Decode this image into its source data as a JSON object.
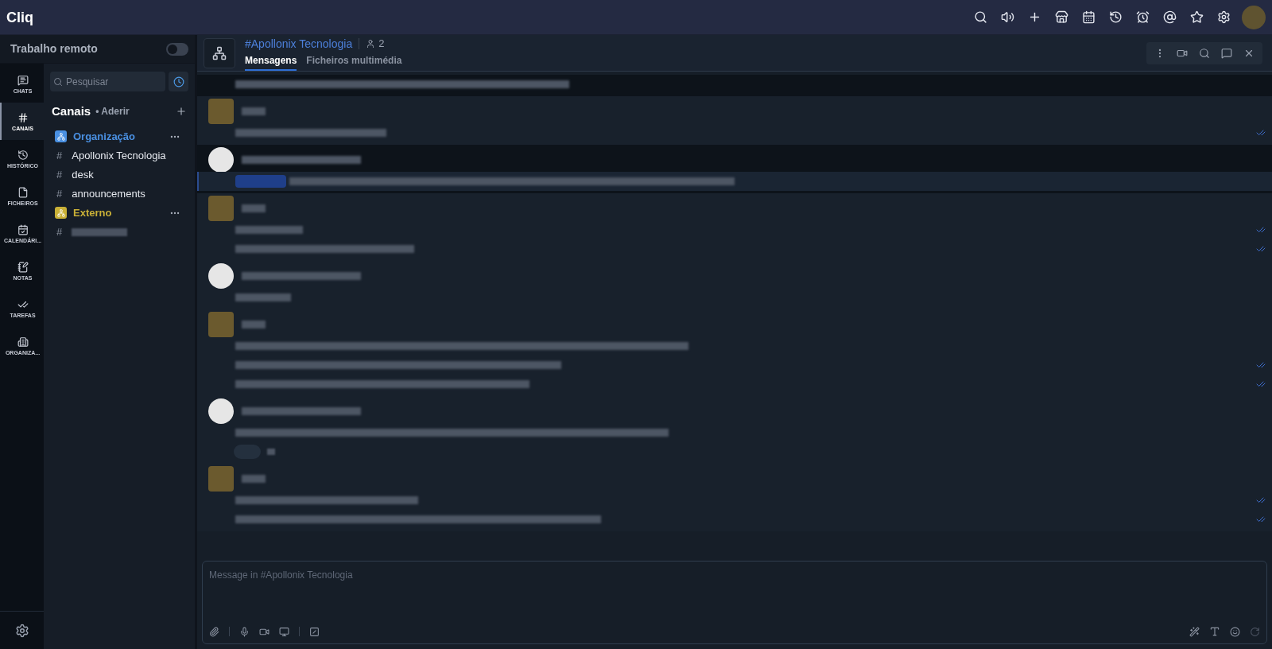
{
  "app": {
    "title": "Cliq"
  },
  "top_actions": [
    {
      "kind": "search"
    },
    {
      "kind": "speaker"
    },
    {
      "kind": "plus"
    },
    {
      "kind": "store"
    },
    {
      "kind": "calendar"
    },
    {
      "kind": "history"
    },
    {
      "kind": "alarm"
    },
    {
      "kind": "at"
    },
    {
      "kind": "star"
    },
    {
      "kind": "settings"
    }
  ],
  "status": {
    "label": "Trabalho remoto",
    "on": false
  },
  "rail": [
    {
      "kind": "chats",
      "label": "CHATS",
      "selected": false
    },
    {
      "kind": "channels",
      "label": "CANAIS",
      "selected": true
    },
    {
      "kind": "history",
      "label": "HISTÓRICO",
      "selected": false
    },
    {
      "kind": "files",
      "label": "FICHEIROS",
      "selected": false
    },
    {
      "kind": "calendar",
      "label": "CALENDÁRI...",
      "selected": false
    },
    {
      "kind": "notes",
      "label": "NOTAS",
      "selected": false
    },
    {
      "kind": "tasks",
      "label": "TAREFAS",
      "selected": false
    },
    {
      "kind": "org",
      "label": "ORGANIZA...",
      "selected": false
    }
  ],
  "search": {
    "placeholder": "Pesquisar"
  },
  "channels_header": {
    "title": "Canais",
    "join": "• Aderir"
  },
  "channel_groups": [
    {
      "name": "Organização",
      "color": "#4a90e2",
      "channels": [
        {
          "kind": "text",
          "prefix": "#",
          "name": "Apollonix Tecnologia"
        },
        {
          "kind": "text",
          "prefix": "#",
          "name": "desk"
        },
        {
          "kind": "text",
          "prefix": "#",
          "name": "announcements"
        }
      ]
    },
    {
      "name": "Externo",
      "color": "#c9b037",
      "channels": [
        {
          "kind": "redacted",
          "prefix": "#"
        }
      ]
    }
  ],
  "chat_header": {
    "title": "#Apollonix Tecnologia",
    "members": "2"
  },
  "chat_tabs": [
    {
      "label": "Mensagens",
      "selected": true
    },
    {
      "label": "Ficheiros multimédia",
      "selected": false
    }
  ],
  "header_actions": [
    {
      "kind": "more"
    },
    {
      "kind": "video"
    },
    {
      "kind": "search"
    },
    {
      "kind": "thread"
    },
    {
      "kind": "close"
    }
  ],
  "message_groups": [
    {
      "kind": "continuation",
      "shaded": true,
      "lines": [
        {
          "read": false,
          "mention": false
        }
      ]
    },
    {
      "kind": "photo",
      "shaded": false,
      "lines": [
        {
          "read": true,
          "mention": false
        }
      ]
    },
    {
      "kind": "plain",
      "shaded": true,
      "lines": [
        {
          "read": false,
          "mention": true
        }
      ]
    },
    {
      "kind": "photo",
      "shaded": false,
      "lines": [
        {
          "read": true,
          "mention": false
        },
        {
          "read": true,
          "mention": false
        }
      ]
    },
    {
      "kind": "plain",
      "shaded": false,
      "lines": [
        {
          "read": false,
          "mention": false
        }
      ]
    },
    {
      "kind": "photo",
      "shaded": false,
      "lines": [
        {
          "read": false,
          "mention": false
        },
        {
          "read": true,
          "mention": false
        },
        {
          "read": true,
          "mention": false
        }
      ]
    },
    {
      "kind": "plain",
      "shaded": false,
      "reaction": true,
      "lines": [
        {
          "read": false,
          "mention": false
        }
      ]
    },
    {
      "kind": "photo",
      "shaded": false,
      "lines": [
        {
          "read": true,
          "mention": false
        },
        {
          "read": true,
          "mention": false
        }
      ]
    }
  ],
  "composer": {
    "placeholder": "Message in #Apollonix Tecnologia"
  }
}
